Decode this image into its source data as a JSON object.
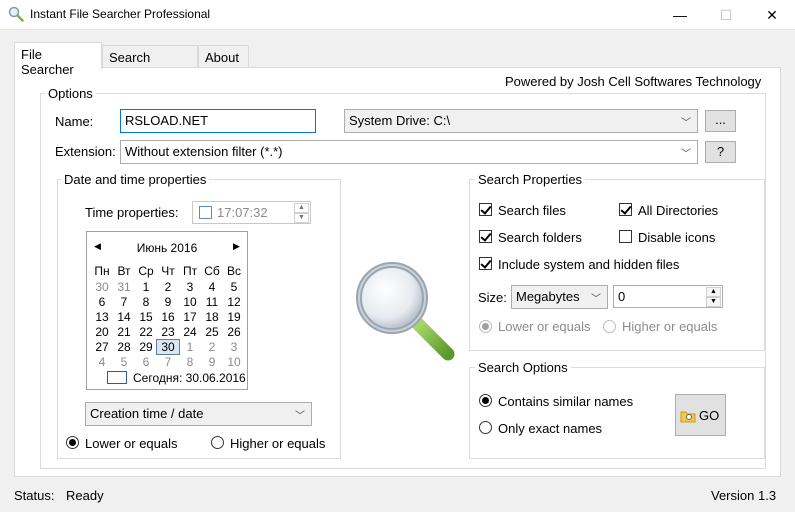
{
  "window": {
    "title": "Instant File Searcher Professional",
    "minimize": "—",
    "maximize": "☐",
    "close": "✕"
  },
  "tabs": [
    {
      "label": "File Searcher"
    },
    {
      "label": "Search Results"
    },
    {
      "label": "About"
    }
  ],
  "powered_by": "Powered by Josh Cell Softwares Technology",
  "options": {
    "title": "Options",
    "name_label": "Name:",
    "name_value": "RSLOAD.NET",
    "drive_value": "System Drive: C:\\",
    "browse_label": "...",
    "extension_label": "Extension:",
    "extension_value": "Without extension filter (*.*)",
    "help_label": "?"
  },
  "datetime": {
    "title": "Date and time properties",
    "time_label": "Time properties:",
    "time_value": "17:07:32",
    "calendar": {
      "month_label": "Июнь 2016",
      "weekdays": [
        "Пн",
        "Вт",
        "Ср",
        "Чт",
        "Пт",
        "Сб",
        "Вс"
      ],
      "rows": [
        [
          "30",
          "31",
          "1",
          "2",
          "3",
          "4",
          "5"
        ],
        [
          "6",
          "7",
          "8",
          "9",
          "10",
          "11",
          "12"
        ],
        [
          "13",
          "14",
          "15",
          "16",
          "17",
          "18",
          "19"
        ],
        [
          "20",
          "21",
          "22",
          "23",
          "24",
          "25",
          "26"
        ],
        [
          "27",
          "28",
          "29",
          "30",
          "1",
          "2",
          "3"
        ],
        [
          "4",
          "5",
          "6",
          "7",
          "8",
          "9",
          "10"
        ]
      ],
      "today_label": "Сегодня: 30.06.2016"
    },
    "mode_value": "Creation time / date",
    "lower_label": "Lower or equals",
    "higher_label": "Higher or equals"
  },
  "search_props": {
    "title": "Search Properties",
    "search_files": "Search files",
    "all_directories": "All Directories",
    "search_folders": "Search folders",
    "disable_icons": "Disable icons",
    "include_hidden": "Include system and hidden files",
    "size_label": "Size:",
    "size_unit": "Megabytes",
    "size_value": "0",
    "lower_label": "Lower or equals",
    "higher_label": "Higher or equals"
  },
  "search_options": {
    "title": "Search Options",
    "similar_label": "Contains similar names",
    "exact_label": "Only exact names",
    "go_label": "GO"
  },
  "status": {
    "label": "Status:",
    "value": "Ready",
    "version": "Version 1.3"
  }
}
